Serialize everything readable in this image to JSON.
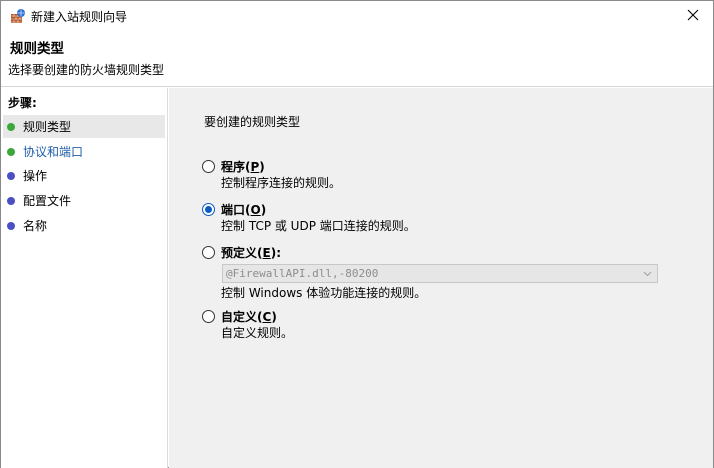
{
  "window": {
    "title": "新建入站规则向导"
  },
  "header": {
    "title": "规则类型",
    "subtitle": "选择要创建的防火墙规则类型"
  },
  "steps": {
    "heading": "步骤:",
    "items": [
      {
        "label": "规则类型",
        "dot_color": "#3aa83a"
      },
      {
        "label": "协议和端口",
        "dot_color": "#3aa83a"
      },
      {
        "label": "操作",
        "dot_color": "#4a4fc4"
      },
      {
        "label": "配置文件",
        "dot_color": "#4a4fc4"
      },
      {
        "label": "名称",
        "dot_color": "#4a4fc4"
      }
    ]
  },
  "main": {
    "prompt": "要创建的规则类型",
    "options": [
      {
        "label": "程序",
        "accel": "P",
        "desc": "控制程序连接的规则。",
        "checked": false
      },
      {
        "label": "端口",
        "accel": "O",
        "desc": "控制 TCP 或 UDP 端口连接的规则。",
        "checked": true
      },
      {
        "label": "预定义",
        "accel": "E",
        "desc": "",
        "checked": false
      },
      {
        "label": "自定义",
        "accel": "C",
        "desc": "自定义规则。",
        "checked": false
      }
    ],
    "predefined_select_value": "@FirewallAPI.dll,-80200",
    "predefined_desc": "控制 Windows 体验功能连接的规则。"
  },
  "colors": {
    "accent": "#0a5bc4",
    "content_bg": "#f0f0f0",
    "link": "#1f5fa8"
  }
}
